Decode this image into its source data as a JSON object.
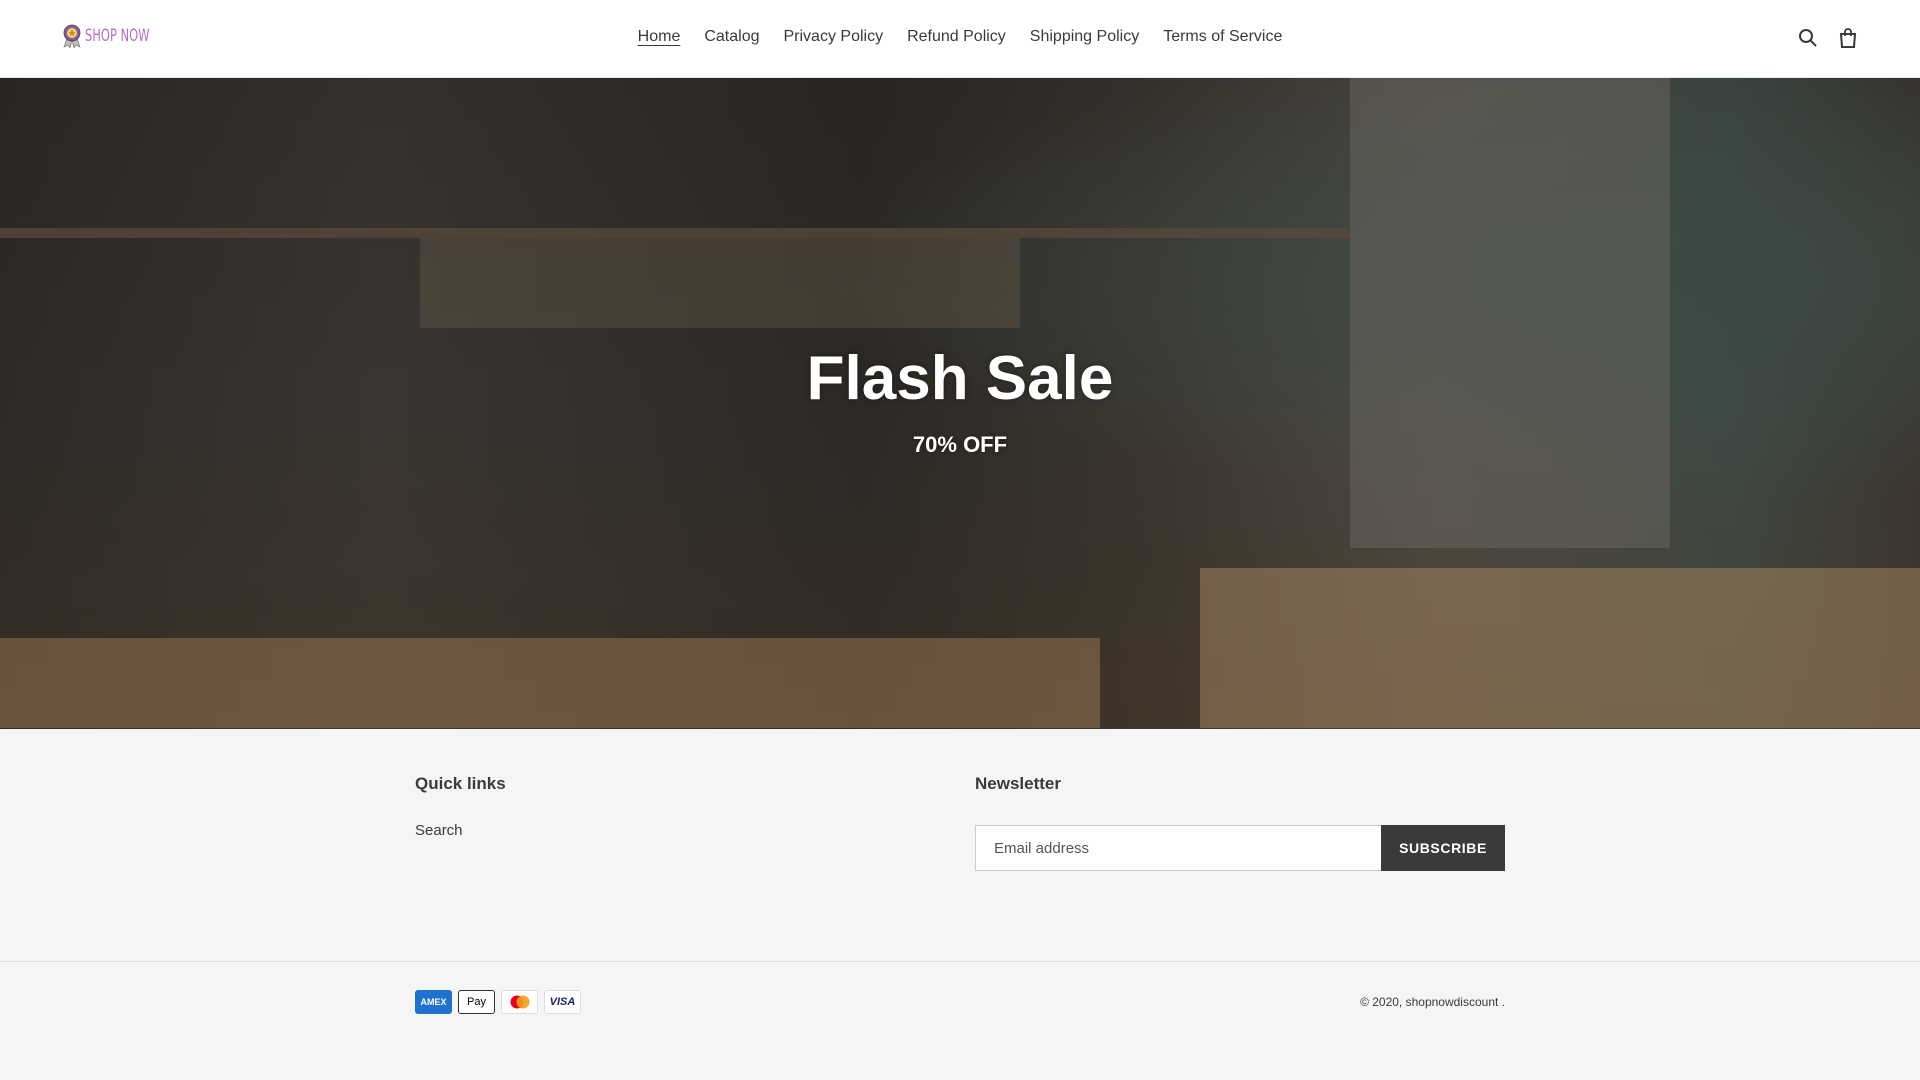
{
  "header": {
    "logo_text": "SHOP NOW",
    "nav": [
      {
        "label": "Home",
        "active": true
      },
      {
        "label": "Catalog"
      },
      {
        "label": "Privacy Policy"
      },
      {
        "label": "Refund Policy"
      },
      {
        "label": "Shipping Policy"
      },
      {
        "label": "Terms of Service"
      }
    ],
    "icons": [
      "search-icon",
      "cart-icon"
    ]
  },
  "hero": {
    "title": "Flash Sale",
    "subtitle": "70% OFF"
  },
  "footer": {
    "quick_links_title": "Quick links",
    "quick_links": [
      "Search"
    ],
    "newsletter_title": "Newsletter",
    "email_placeholder": "Email address",
    "subscribe_label": "SUBSCRIBE",
    "payments": [
      "AMEX",
      "Pay",
      "",
      "VISA"
    ],
    "copyright": "© 2020, shopnowdiscount ."
  }
}
